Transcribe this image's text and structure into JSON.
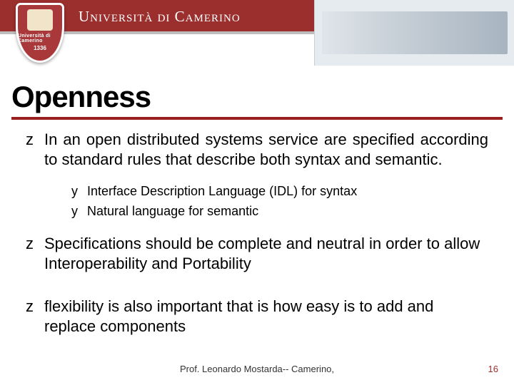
{
  "header": {
    "shield_label": "Università di Camerino",
    "shield_year": "1336",
    "university_name": "Università di Camerino"
  },
  "title": "Openness",
  "bullets": {
    "z1": "In an open distributed systems service are specified according to standard rules that describe both syntax and semantic.",
    "y1": "Interface Description Language (IDL) for syntax",
    "y2": "Natural language for semantic",
    "z2": "Specifications should be complete and neutral in order to allow Interoperability and Portability",
    "z3": "flexibility is also important that is how easy is to add and replace components"
  },
  "markers": {
    "z": "z",
    "y": "y"
  },
  "footer": {
    "center": "Prof. Leonardo Mostarda--   Camerino,",
    "page": "16"
  }
}
